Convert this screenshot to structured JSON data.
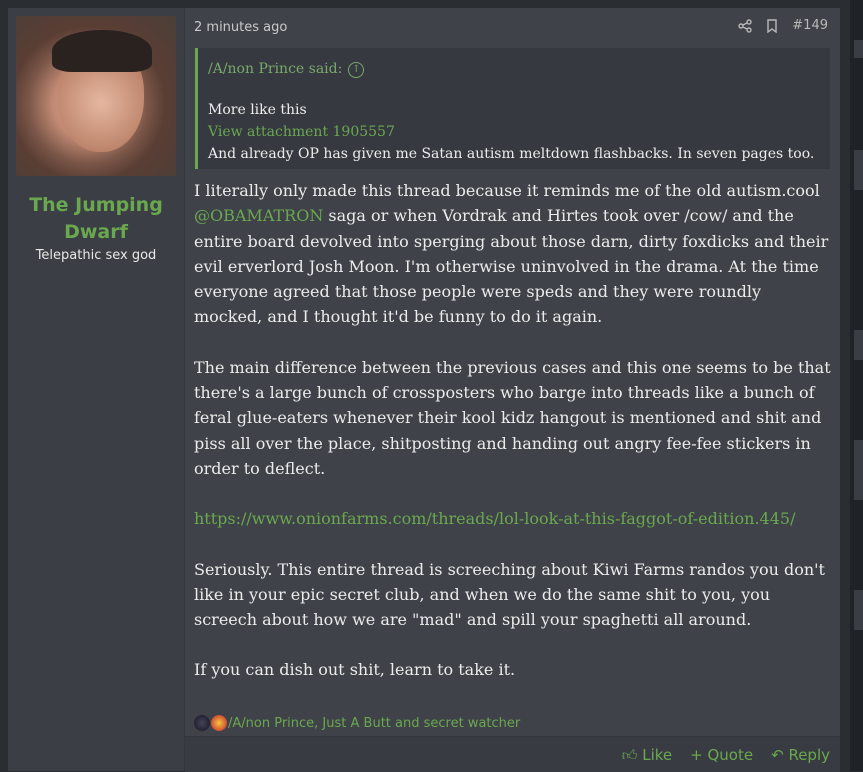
{
  "user": {
    "name": "The Jumping Dwarf",
    "title": "Telepathic sex god"
  },
  "post": {
    "time": "2 minutes ago",
    "number": "#149",
    "quote": {
      "author": "/A/non Prince said:",
      "line1": "More like this",
      "attachment": "View attachment 1905557",
      "line2": "And already OP has given me Satan autism meltdown flashbacks. In seven pages too."
    },
    "p1_a": "I literally only made this thread because it reminds me of the old autism.cool ",
    "p1_mention": "@OBAMATRON",
    "p1_b": " saga or when Vordrak and Hirtes took over /cow/ and the entire board devolved into sperging about those darn, dirty foxdicks and their evil erverlord Josh Moon. I'm otherwise uninvolved in the drama. At the time everyone agreed that those people were speds and they were roundly mocked, and I thought it'd be funny to do it again.",
    "p2": "The main difference between the previous cases and this one seems to be that there's a large bunch of crossposters who barge into threads like a bunch of feral glue-eaters whenever their kool kidz hangout is mentioned and shit and piss all over the place, shitposting and handing out angry fee-fee stickers in order to deflect.",
    "link": "https://www.onionfarms.com/threads/lol-look-at-this-faggot-of-edition.445/",
    "p3": "Seriously. This entire thread is screeching about Kiwi Farms randos you don't like in your epic secret club, and when we do the same shit to you, you screech about how we are \"mad\" and spill your spaghetti all around.",
    "p4": "If you can dish out shit, learn to take it.",
    "reactions": "/A/non Prince, Just A Butt and secret watcher"
  },
  "actions": {
    "like": "Like",
    "quote": "+ Quote",
    "reply": "Reply"
  }
}
